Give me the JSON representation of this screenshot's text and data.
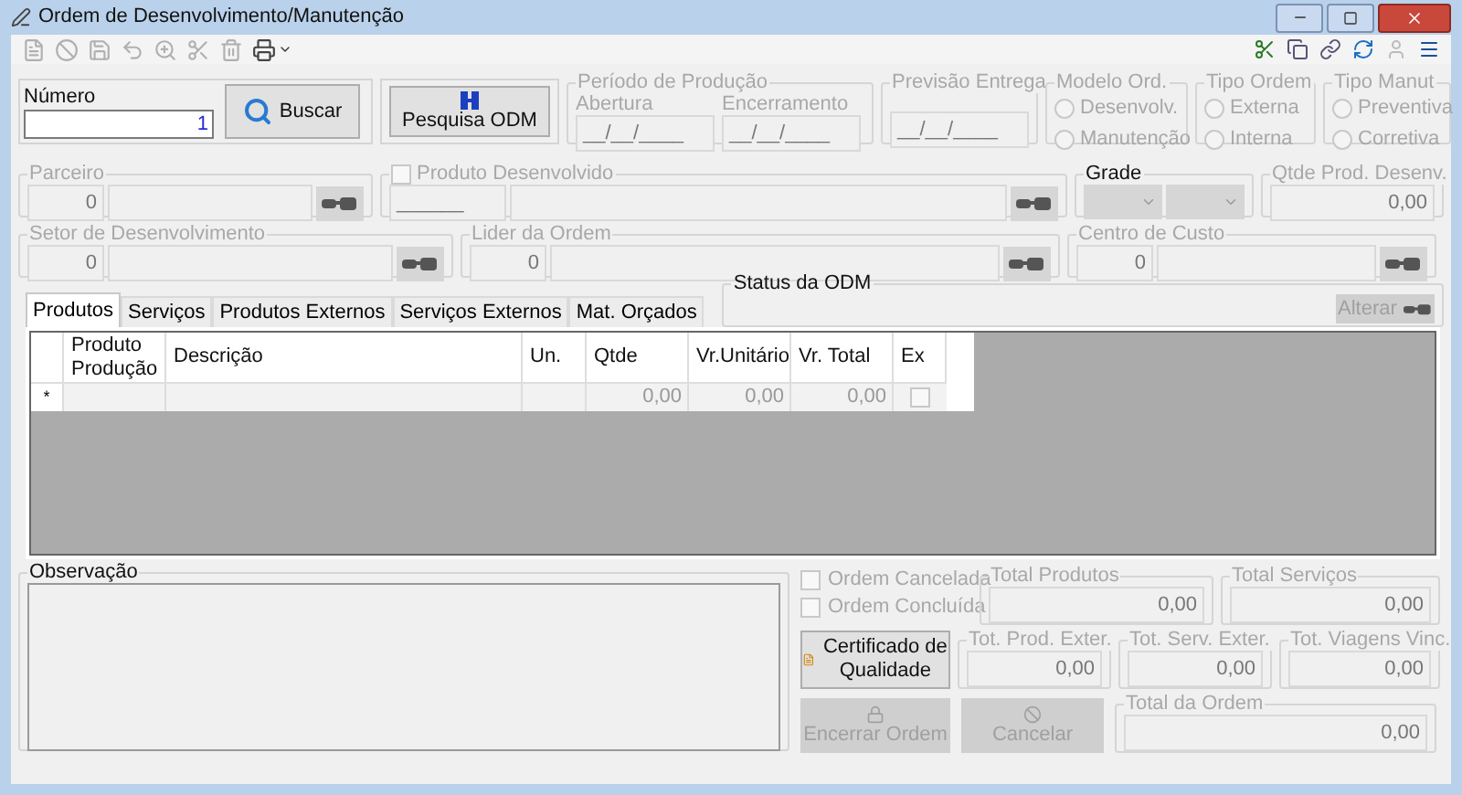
{
  "window": {
    "title": "Ordem de Desenvolvimento/Manutenção"
  },
  "numero": {
    "label": "Número",
    "value": "1"
  },
  "buscar_button": {
    "label": "Buscar",
    "disabled": false
  },
  "pesquisa_button": {
    "label": "Pesquisa ODM",
    "disabled": false
  },
  "periodo": {
    "title": "Período de Produção",
    "fields": [
      {
        "label": "Abertura",
        "value": "__/__/____"
      },
      {
        "label": "Encerramento",
        "value": "__/__/____"
      }
    ]
  },
  "previsao": {
    "title": "Previsão Entrega",
    "value": "__/__/____"
  },
  "radio_groups": [
    {
      "title": "Modelo Ord.",
      "options": [
        {
          "label": "Desenvolv.",
          "selected": false
        },
        {
          "label": "Manutenção",
          "selected": false
        }
      ]
    },
    {
      "title": "Tipo Ordem",
      "options": [
        {
          "label": "Externa",
          "selected": false
        },
        {
          "label": "Interna",
          "selected": false
        }
      ]
    },
    {
      "title": "Tipo Manut",
      "options": [
        {
          "label": "Preventiva",
          "selected": false
        },
        {
          "label": "Corretiva",
          "selected": false
        }
      ]
    }
  ],
  "parceiro": {
    "title": "Parceiro",
    "code": "0"
  },
  "produto": {
    "title": "Produto Desenvolvido",
    "checked": false,
    "code": "______"
  },
  "grade": {
    "title": "Grade"
  },
  "qtde": {
    "title": "Qtde Prod. Desenv.",
    "value": "0,00"
  },
  "setor": {
    "title": "Setor de Desenvolvimento",
    "code": "0"
  },
  "lider": {
    "title": "Lider da Ordem",
    "code": "0"
  },
  "centro": {
    "title": "Centro de Custo",
    "code": "0"
  },
  "tabs": [
    {
      "label": "Produtos",
      "selected": true
    },
    {
      "label": "Serviços",
      "selected": false
    },
    {
      "label": "Produtos Externos",
      "selected": false
    },
    {
      "label": "Serviços Externos",
      "selected": false
    },
    {
      "label": "Mat. Orçados",
      "selected": false
    }
  ],
  "status": {
    "title": "Status da ODM",
    "button": {
      "label": "Alterar",
      "disabled": true
    }
  },
  "grid": {
    "columns": [
      "Produto Produção",
      "Descrição",
      "Un.",
      "Qtde",
      "Vr.Unitário",
      "Vr. Total",
      "Ex"
    ],
    "rows": [
      {
        "marker": "*",
        "cells": [
          "",
          "",
          "",
          "0,00",
          "0,00",
          "0,00"
        ],
        "ex": false
      }
    ]
  },
  "observacao": {
    "title": "Observação"
  },
  "checkboxes": [
    {
      "label": "Ordem Cancelada",
      "checked": false
    },
    {
      "label": "Ordem Concluída",
      "checked": false
    }
  ],
  "totals_top": [
    {
      "label": "Total Produtos",
      "value": "0,00"
    },
    {
      "label": "Total Serviços",
      "value": "0,00"
    }
  ],
  "totals_mid": [
    {
      "label": "Tot. Prod. Exter.",
      "value": "0,00"
    },
    {
      "label": "Tot. Serv. Exter.",
      "value": "0,00"
    },
    {
      "label": "Tot. Viagens Vinc.",
      "value": "0,00"
    }
  ],
  "certificado_button": {
    "label": "Certificado de Qualidade",
    "disabled": false
  },
  "encerrar_button": {
    "label": "Encerrar Ordem",
    "disabled": true
  },
  "cancelar_button": {
    "label": "Cancelar",
    "disabled": true
  },
  "total_ordem": {
    "label": "Total da Ordem",
    "value": "0,00"
  }
}
